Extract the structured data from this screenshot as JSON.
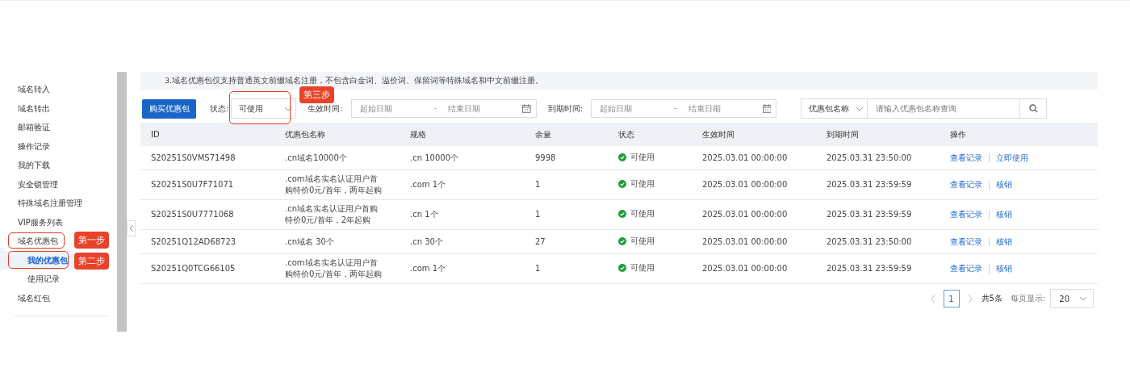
{
  "sidebar": {
    "items": [
      {
        "label": "域名转入",
        "selected": false
      },
      {
        "label": "域名转出",
        "selected": false
      },
      {
        "label": "邮箱验证",
        "selected": false
      },
      {
        "label": "操作记录",
        "selected": false
      },
      {
        "label": "我的下载",
        "selected": false
      },
      {
        "label": "安全锁管理",
        "selected": false
      },
      {
        "label": "特殊域名注册管理",
        "selected": false
      },
      {
        "label": "VIP服务列表",
        "selected": false
      },
      {
        "label": "域名优惠包",
        "selected": false,
        "annotation": "第一步",
        "children": [
          {
            "label": "我的优惠包",
            "selected": true,
            "annotation": "第二步"
          },
          {
            "label": "使用记录",
            "selected": false
          }
        ]
      },
      {
        "label": "域名红包",
        "selected": false
      }
    ]
  },
  "notice": "3.域名优惠包仅支持普通英文前缀域名注册，不包含白金词、溢价词、保留词等特殊域名和中文前缀注册。",
  "toolbar": {
    "buy_button": "购买优惠包",
    "status_filter": {
      "label": "状态:",
      "value": "可使用",
      "annotation": "第三步"
    },
    "date_filters": [
      {
        "label": "生效时间:",
        "start_placeholder": "起始日期",
        "end_placeholder": "结束日期"
      },
      {
        "label": "到期时间:",
        "start_placeholder": "起始日期",
        "end_placeholder": "结束日期"
      }
    ],
    "search": {
      "field": "优惠包名称",
      "placeholder": "请输入优惠包名称查询"
    }
  },
  "table": {
    "columns": [
      "ID",
      "优惠包名称",
      "规格",
      "余量",
      "状态",
      "生效时间",
      "到期时间",
      "操作"
    ],
    "rows": [
      {
        "id": "S20251S0VMS71498",
        "name": ".cn域名10000个",
        "spec": ".cn 10000个",
        "remaining": "9998",
        "status": {
          "kind": "available",
          "text": "可使用"
        },
        "start": "2025.03.01 00:00:00",
        "end": "2025.03.31 23:50:00",
        "actions": [
          "查看记录",
          "立即使用"
        ]
      },
      {
        "id": "S20251S0U7F71071",
        "name": ".com域名实名认证用户首购特价0元/首年，两年起购",
        "spec": ".com 1个",
        "remaining": "1",
        "status": {
          "kind": "available",
          "text": "可使用"
        },
        "start": "2025.03.01 00:00:00",
        "end": "2025.03.31 23:59:59",
        "actions": [
          "查看记录",
          "核销"
        ]
      },
      {
        "id": "S20251S0U7771068",
        "name": ".cn域名实名认证用户首购特价0元/首年，2年起购",
        "spec": ".cn 1个",
        "remaining": "1",
        "status": {
          "kind": "available",
          "text": "可使用"
        },
        "start": "2025.03.01 00:00:00",
        "end": "2025.03.31 23:59:59",
        "actions": [
          "查看记录",
          "核销"
        ]
      },
      {
        "id": "S20251Q12AD68723",
        "name": ".cn域名 30个",
        "spec": ".cn 30个",
        "remaining": "27",
        "status": {
          "kind": "available",
          "text": "可使用"
        },
        "start": "2025.03.01 00:00:00",
        "end": "2025.03.31 23:50:00",
        "actions": [
          "查看记录",
          "核销"
        ]
      },
      {
        "id": "S20251Q0TCG66105",
        "name": ".com域名实名认证用户首购特价0元/首年，两年起购",
        "spec": ".com 1个",
        "remaining": "1",
        "status": {
          "kind": "available",
          "text": "可使用"
        },
        "start": "2025.03.01 00:00:00",
        "end": "2025.03.31 23:59:59",
        "actions": [
          "查看记录",
          "核销"
        ]
      }
    ]
  },
  "pagination": {
    "pages": [
      {
        "label": "1",
        "selected": true
      }
    ],
    "total": "共5条",
    "page_size_label": "每页显示:",
    "page_size": "20"
  }
}
